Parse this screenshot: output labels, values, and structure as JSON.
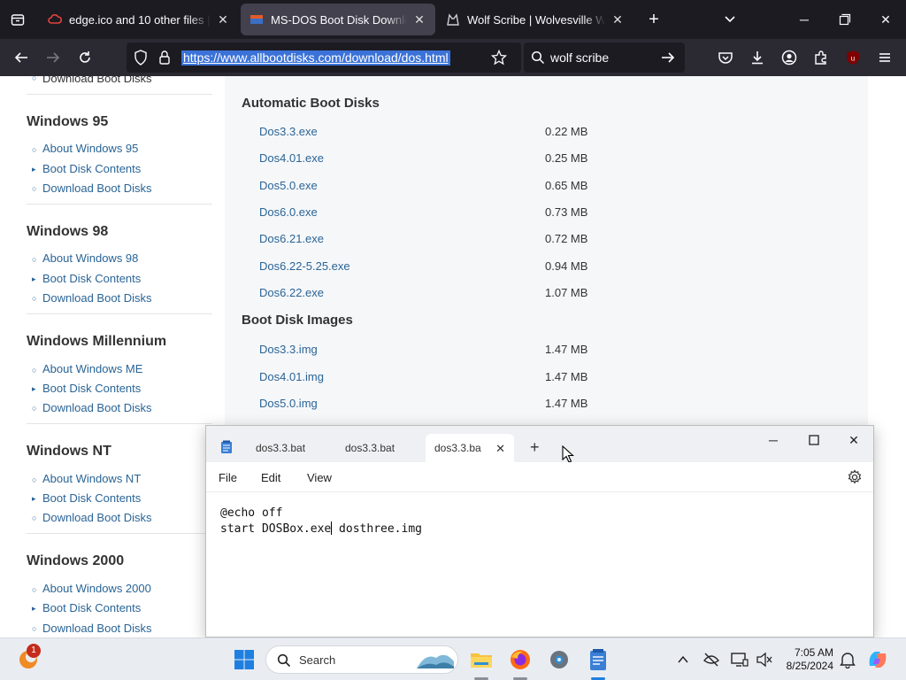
{
  "browser": {
    "tabs": [
      {
        "title": "edge.ico and 10 other files | File"
      },
      {
        "title": "MS-DOS Boot Disk Download | "
      },
      {
        "title": "Wolf Scribe | Wolvesville Wiki | "
      }
    ],
    "new_tab_label": "+",
    "url": "https://www.allbootdisks.com/download/dos.html",
    "search_value": "wolf scribe",
    "extension_badge": "2"
  },
  "sidebar": {
    "top_link": "Download Boot Disks",
    "sections": [
      {
        "heading": "Windows 95",
        "links": [
          "About Windows 95",
          "Boot Disk Contents",
          "Download Boot Disks"
        ]
      },
      {
        "heading": "Windows 98",
        "links": [
          "About Windows 98",
          "Boot Disk Contents",
          "Download Boot Disks"
        ]
      },
      {
        "heading": "Windows Millennium",
        "links": [
          "About Windows ME",
          "Boot Disk Contents",
          "Download Boot Disks"
        ]
      },
      {
        "heading": "Windows NT",
        "links": [
          "About Windows NT",
          "Boot Disk Contents",
          "Download Boot Disks"
        ]
      },
      {
        "heading": "Windows 2000",
        "links": [
          "About Windows 2000",
          "Boot Disk Contents",
          "Download Boot Disks"
        ]
      }
    ]
  },
  "main": {
    "automatic_heading": "Automatic Boot Disks",
    "automatic_files": [
      {
        "name": "Dos3.3.exe",
        "size": "0.22 MB"
      },
      {
        "name": "Dos4.01.exe",
        "size": "0.25 MB"
      },
      {
        "name": "Dos5.0.exe",
        "size": "0.65 MB"
      },
      {
        "name": "Dos6.0.exe",
        "size": "0.73 MB"
      },
      {
        "name": "Dos6.21.exe",
        "size": "0.72 MB"
      },
      {
        "name": "Dos6.22-5.25.exe",
        "size": "0.94 MB"
      },
      {
        "name": "Dos6.22.exe",
        "size": "1.07 MB"
      }
    ],
    "images_heading": "Boot Disk Images",
    "image_files": [
      {
        "name": "Dos3.3.img",
        "size": "1.47 MB"
      },
      {
        "name": "Dos4.01.img",
        "size": "1.47 MB"
      },
      {
        "name": "Dos5.0.img",
        "size": "1.47 MB"
      }
    ]
  },
  "notepad": {
    "tabs": [
      {
        "title": "dos3.3.bat"
      },
      {
        "title": "dos3.3.bat"
      },
      {
        "title": "dos3.3.ba"
      }
    ],
    "new_tab_label": "+",
    "menu": [
      "File",
      "Edit",
      "View"
    ],
    "lines": [
      "@echo off",
      "start DOSBox.exe",
      " dosthree.img"
    ]
  },
  "taskbar": {
    "search_label": "Search",
    "notification_count": "1",
    "time": "7:05 AM",
    "date": "8/25/2024"
  },
  "colors": {
    "browser_dark": "#1c1b22",
    "link_blue": "#2a6496",
    "url_highlight": "#3b72d8"
  }
}
